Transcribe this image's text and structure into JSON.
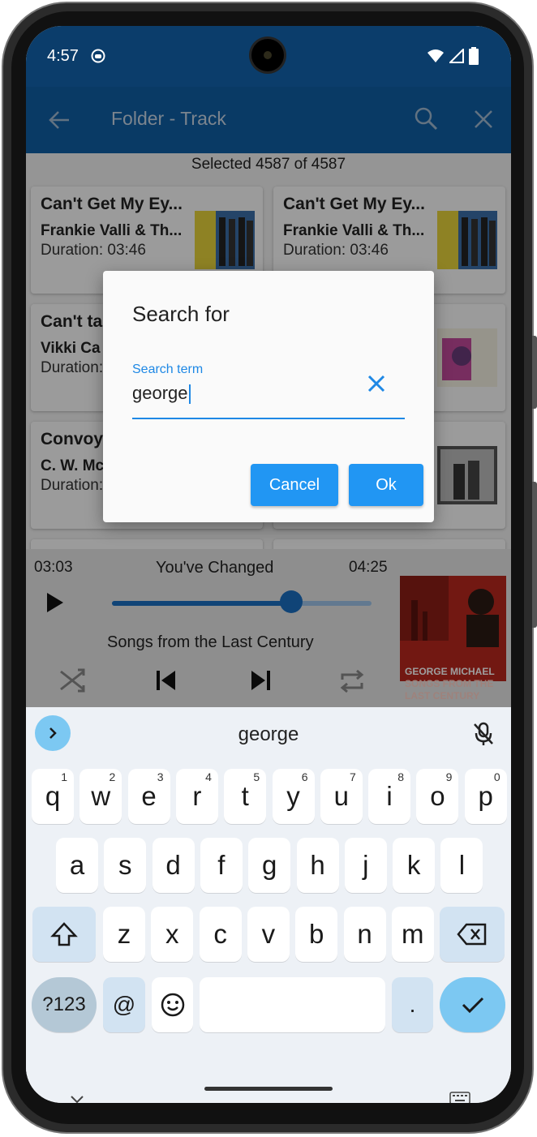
{
  "status_bar": {
    "time": "4:57"
  },
  "app_bar": {
    "title": "Folder - Track"
  },
  "selection_text": "Selected 4587 of 4587",
  "cards": [
    {
      "title": "Can't Get My Ey...",
      "artist": "Frankie Valli & Th...",
      "duration": "Duration: 03:46"
    },
    {
      "title": "Can't Get My Ey...",
      "artist": "Frankie Valli & Th...",
      "duration": "Duration: 03:46"
    },
    {
      "title": "Can't tal",
      "artist": "Vikki Ca",
      "duration": "Duration:"
    },
    {
      "title": "Convoy",
      "artist": "C. W. Mc",
      "duration": "Duration:"
    }
  ],
  "player": {
    "elapsed": "03:03",
    "song": "You've Changed",
    "total": "04:25",
    "album": "Songs from the Last Century",
    "progress_fraction": 0.69
  },
  "album_art_text": [
    "GEORGE MICHAEL",
    "SONGS FROM THE",
    "LAST CENTURY"
  ],
  "dialog": {
    "title": "Search for",
    "field_label": "Search term",
    "field_value": "george",
    "cancel_label": "Cancel",
    "ok_label": "Ok"
  },
  "keyboard": {
    "suggestion": "george",
    "row1": [
      [
        "q",
        "1"
      ],
      [
        "w",
        "2"
      ],
      [
        "e",
        "3"
      ],
      [
        "r",
        "4"
      ],
      [
        "t",
        "5"
      ],
      [
        "y",
        "6"
      ],
      [
        "u",
        "7"
      ],
      [
        "i",
        "8"
      ],
      [
        "o",
        "9"
      ],
      [
        "p",
        "0"
      ]
    ],
    "row2": [
      "a",
      "s",
      "d",
      "f",
      "g",
      "h",
      "j",
      "k",
      "l"
    ],
    "row3": [
      "z",
      "x",
      "c",
      "v",
      "b",
      "n",
      "m"
    ],
    "symbols_label": "?123",
    "at_label": "@",
    "period_label": "."
  },
  "colors": {
    "app_bar": "#0f5ea3",
    "status_bar": "#0b3d6b",
    "accent": "#2196f3"
  }
}
